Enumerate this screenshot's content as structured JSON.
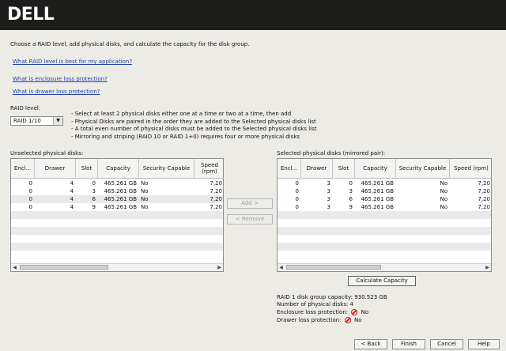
{
  "header": {
    "logo": "DELL"
  },
  "intro": "Choose a RAID level, add physical disks, and calculate the capacity for the disk group.",
  "links": [
    "What RAID level is best for my application?",
    "What is enclosure loss protection?",
    "What is drawer loss protection?"
  ],
  "raid": {
    "label": "RAID level:",
    "selected": "RAID 1/10",
    "notes": [
      "- Select at least 2 physical disks either one at a time or two at a time, then add",
      "- Physical Disks are paired in the order they are added to the Selected physical disks list",
      "- A total even number of physical disks must be added to the Selected physical disks list",
      "- Mirroring and striping (RAID 10 or RAID 1+0) requires four or more physical disks"
    ]
  },
  "unselected": {
    "title": "Unselected physical disks:",
    "columns": [
      "Encl...",
      "Drawer",
      "Slot",
      "Capacity",
      "Security Capable",
      "Speed (rpm)"
    ],
    "rows": [
      [
        "0",
        "4",
        "0",
        "465.261 GB",
        "No",
        "7,20"
      ],
      [
        "0",
        "4",
        "3",
        "465.261 GB",
        "No",
        "7,20"
      ],
      [
        "0",
        "4",
        "6",
        "465.261 GB",
        "No",
        "7,20"
      ],
      [
        "0",
        "4",
        "9",
        "465.261 GB",
        "No",
        "7,20"
      ]
    ]
  },
  "selected": {
    "title": "Selected physical disks (mirrored pair):",
    "columns": [
      "Encl...",
      "Drawer",
      "Slot",
      "Capacity",
      "Security Capable",
      "Speed (rpm)"
    ],
    "rows": [
      [
        "0",
        "3",
        "0",
        "465.261 GB",
        "No",
        "7,20"
      ],
      [
        "0",
        "3",
        "3",
        "465.261 GB",
        "No",
        "7,20"
      ],
      [
        "0",
        "3",
        "6",
        "465.261 GB",
        "No",
        "7,20"
      ],
      [
        "0",
        "3",
        "9",
        "465.261 GB",
        "No",
        "7,20"
      ]
    ]
  },
  "buttons": {
    "add": "Add >",
    "remove": "< Remove",
    "calculate": "Calculate Capacity",
    "back": "< Back",
    "finish": "Finish",
    "cancel": "Cancel",
    "help": "Help"
  },
  "summary": {
    "capacity": "RAID 1 disk group capacity: 930.523 GB",
    "disks": "Number of physical disks: 4",
    "enclosure_label": "Enclosure loss protection:",
    "enclosure_value": "No",
    "drawer_label": "Drawer loss protection:",
    "drawer_value": "No"
  },
  "colors": {
    "no_icon": "#d0201a",
    "link": "#1f3fb3"
  }
}
